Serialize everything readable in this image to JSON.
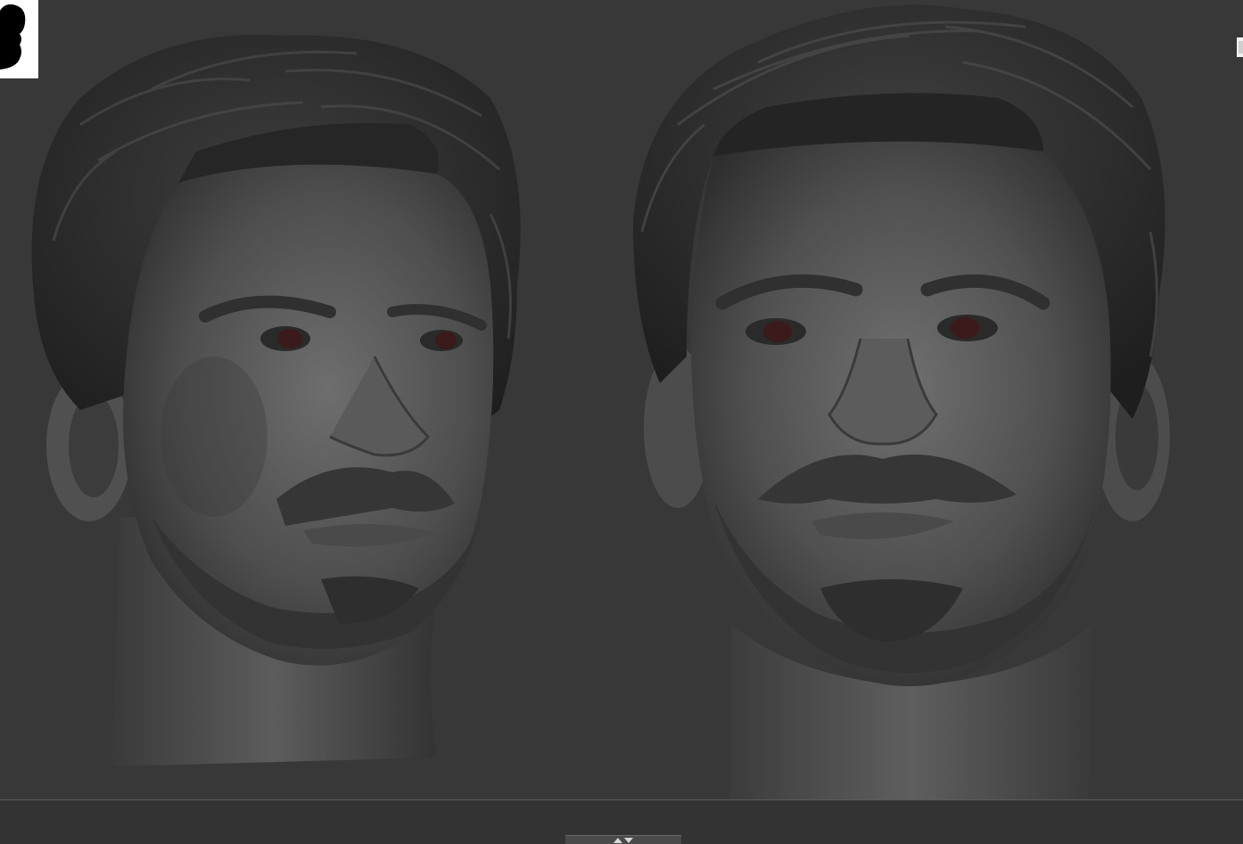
{
  "viewport": {
    "background": "#383838"
  },
  "thumbnail": {
    "icon": "head-silhouette-icon"
  },
  "models": [
    {
      "name": "head-sculpt-three-quarter-view",
      "view": "three-quarter-left",
      "material": "matcap-gray"
    },
    {
      "name": "head-sculpt-front-view",
      "view": "front",
      "material": "matcap-gray"
    }
  ],
  "colors": {
    "sculpt_dark": "#2a2a2a",
    "sculpt_mid": "#4a4a4a",
    "sculpt_light": "#6a6a6a",
    "eye": "#3a1a1a"
  }
}
